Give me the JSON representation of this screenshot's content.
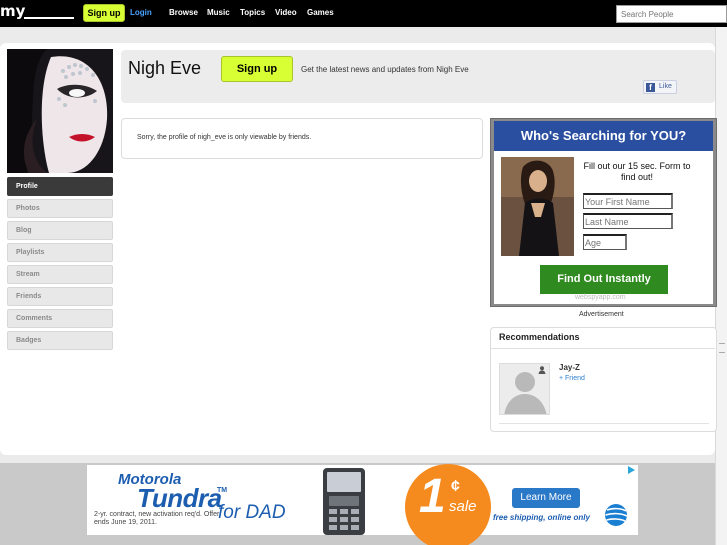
{
  "topbar": {
    "logo_text": "my",
    "signup_label": "Sign up",
    "login_label": "Login",
    "nav": [
      "Browse",
      "Music",
      "Topics",
      "Video",
      "Games"
    ],
    "search_placeholder": "Search People"
  },
  "profile": {
    "name": "Nigh Eve",
    "signup_label": "Sign up",
    "tagline": "Get the latest news and updates from Nigh Eve",
    "like_label": "Like",
    "private_message": "Sorry, the profile of nigh_eve is only viewable by friends."
  },
  "sidebar": {
    "items": [
      {
        "label": "Profile",
        "active": true
      },
      {
        "label": "Photos",
        "active": false
      },
      {
        "label": "Blog",
        "active": false
      },
      {
        "label": "Playlists",
        "active": false
      },
      {
        "label": "Stream",
        "active": false
      },
      {
        "label": "Friends",
        "active": false
      },
      {
        "label": "Comments",
        "active": false
      },
      {
        "label": "Badges",
        "active": false
      }
    ]
  },
  "ad": {
    "headline": "Who's Searching for YOU?",
    "prompt": "Fill out our 15 sec. Form to find out!",
    "fields": [
      "Your First Name",
      "Last Name",
      "Age"
    ],
    "cta": "Find Out Instantly",
    "domain": "webspyapp.com",
    "caption": "Advertisement"
  },
  "recommendations": {
    "title": "Recommendations",
    "items": [
      {
        "name": "Jay-Z",
        "action": "+ Friend"
      }
    ]
  },
  "banner": {
    "brand": "Motorola",
    "product": "Tundra",
    "tm": "TM",
    "for_text": "for DAD",
    "fine_print": "2-yr. contract, new activation req'd. Offer ends June 19, 2011.",
    "price": "1",
    "cent_symbol": "¢",
    "sale": "sale",
    "learn_more": "Learn More",
    "shipping": "free shipping, online only"
  },
  "colors": {
    "signup_green": "#d7ff33",
    "link_blue": "#4aa3ff",
    "ad_header_blue": "#2b4fa0",
    "cta_green": "#2f8a1f",
    "banner_orange": "#f58b1f"
  }
}
